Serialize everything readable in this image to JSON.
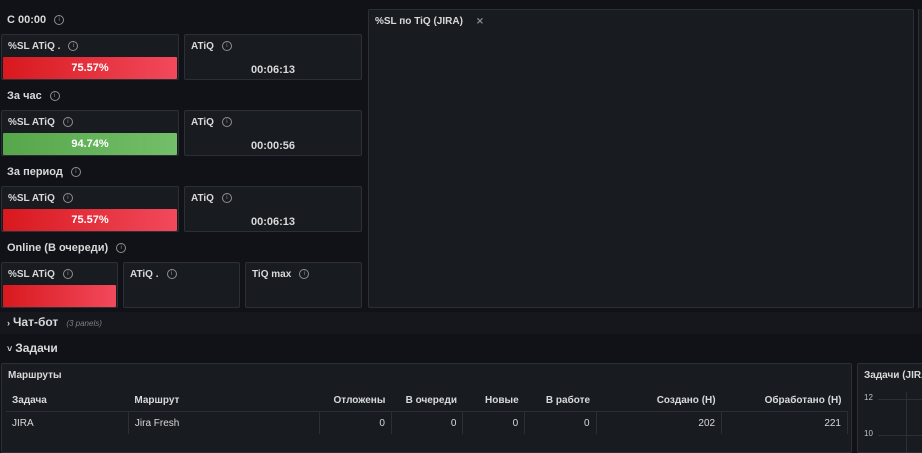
{
  "groups": [
    {
      "title": "С 00:00",
      "sl_label": "%SL ATiQ .",
      "sl_value": "75.57%",
      "atiq_label": "ATiQ",
      "atiq_value": "00:06:13"
    },
    {
      "title": "За час",
      "sl_label": "%SL ATiQ",
      "sl_value": "94.74%",
      "atiq_label": "ATiQ",
      "atiq_value": "00:00:56"
    },
    {
      "title": "За период",
      "sl_label": "%SL ATiQ",
      "sl_value": "75.57%",
      "atiq_label": "ATiQ",
      "atiq_value": "00:06:13"
    }
  ],
  "online": {
    "title": "Online (В очереди)",
    "sl_label": "%SL ATiQ",
    "atiq_label": "ATiQ .",
    "tiq_label": "TiQ max"
  },
  "graph_panel": {
    "title": "%SL по TiQ (JIRA)"
  },
  "rows": {
    "chatbot": {
      "label": "Чат-бот",
      "panels_note": "(3 panels)"
    },
    "tasks": {
      "label": "Задачи"
    }
  },
  "routes_panel": {
    "title": "Маршруты",
    "columns": [
      "Задача",
      "Маршрут",
      "Отложены",
      "В очереди",
      "Новые",
      "В работе",
      "Создано (Н)",
      "Обработано (Н)"
    ],
    "rows": [
      [
        "JIRA",
        "Jira Fresh",
        "0",
        "0",
        "0",
        "0",
        "202",
        "221"
      ]
    ]
  },
  "tasks_chart": {
    "title": "Задачи (JIRA",
    "y_ticks": [
      "12",
      "10"
    ]
  },
  "colors": {
    "bg": "#111217",
    "panel": "#181b1f",
    "red": "#f2495c",
    "green": "#73bf69"
  }
}
